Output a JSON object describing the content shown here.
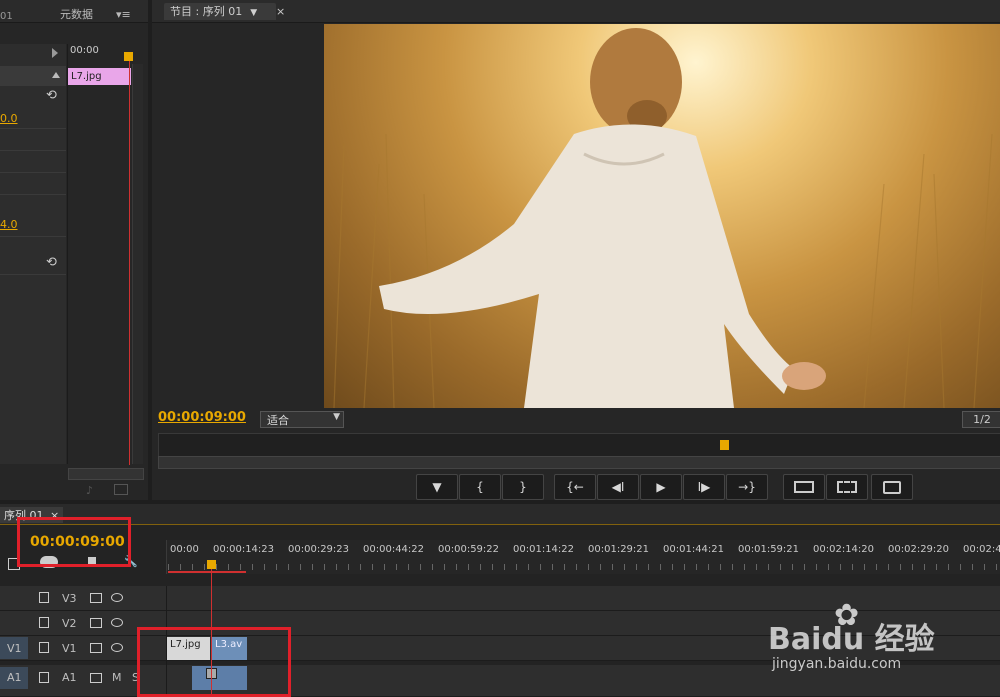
{
  "source_panel": {
    "tab_fragment": "01",
    "metadata_tab": "元数据",
    "menu_glyph": "▾≡",
    "ruler_time": "00:00",
    "clip_name": "L7.jpg",
    "value_1": "0.0",
    "value_2": "4.0"
  },
  "program_monitor": {
    "tab_label": "节目 : 序列 01",
    "close": "×",
    "timecode": "00:00:09:00",
    "zoom": "适合",
    "resolution": "1/2",
    "controls": [
      "▼",
      "{",
      "}",
      "{←",
      "◀I",
      "▶",
      "I▶",
      "→}",
      "",
      "",
      ""
    ]
  },
  "timeline": {
    "tab_label": "序列 01",
    "close": "×",
    "timecode": "00:00:09:00",
    "ruler_labels": [
      "00:00",
      "00:00:14:23",
      "00:00:29:23",
      "00:00:44:22",
      "00:00:59:22",
      "00:01:14:22",
      "00:01:29:21",
      "00:01:44:21",
      "00:01:59:21",
      "00:02:14:20",
      "00:02:29:20",
      "00:02:4"
    ],
    "tracks": [
      {
        "src": "",
        "name": "V3"
      },
      {
        "src": "",
        "name": "V2"
      },
      {
        "src": "V1",
        "name": "V1"
      },
      {
        "src": "A1",
        "name": "A1",
        "m": "M",
        "s": "S"
      }
    ],
    "clips": {
      "v1_a": "L7.jpg",
      "v1_b": "L3.av"
    }
  },
  "watermark": {
    "brand": "Baidu 经验",
    "url": "jingyan.baidu.com"
  },
  "colors": {
    "accent": "#e8a800",
    "playhead": "#d03030",
    "clip_pink": "#e9a6e9",
    "clip_blue": "#6d8fb8"
  }
}
